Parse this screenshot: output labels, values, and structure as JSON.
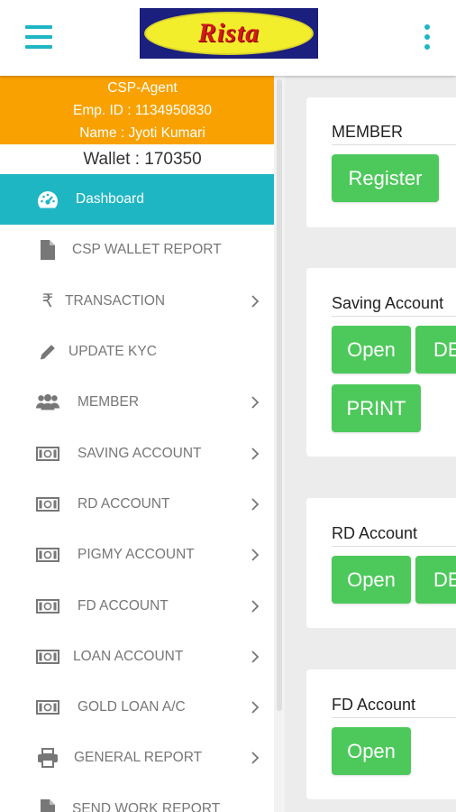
{
  "header": {
    "logo_text": "Rista",
    "menu_icon": "hamburger-menu-icon",
    "overflow_icon": "kebab-menu-icon",
    "brand_color": "#1fb6c4"
  },
  "sidebar": {
    "role": "CSP-Agent",
    "emp_id": "Emp. ID : 1134950830",
    "name": "Name : Jyoti Kumari",
    "wallet": "Wallet : 170350",
    "accent_color": "#f9a100",
    "items": [
      {
        "label": "Dashboard",
        "icon": "dashboard-gauge-icon",
        "active": true,
        "chevron": false
      },
      {
        "label": "CSP WALLET REPORT",
        "icon": "document-icon",
        "active": false,
        "chevron": false
      },
      {
        "label": "TRANSACTION",
        "icon": "rupee-icon",
        "active": false,
        "chevron": true
      },
      {
        "label": "UPDATE KYC",
        "icon": "pencil-icon",
        "active": false,
        "chevron": false
      },
      {
        "label": "MEMBER",
        "icon": "users-icon",
        "active": false,
        "chevron": true
      },
      {
        "label": "SAVING ACCOUNT",
        "icon": "money-icon",
        "active": false,
        "chevron": true
      },
      {
        "label": "RD ACCOUNT",
        "icon": "money-icon",
        "active": false,
        "chevron": true
      },
      {
        "label": "PIGMY ACCOUNT",
        "icon": "money-icon",
        "active": false,
        "chevron": true
      },
      {
        "label": "FD ACCOUNT",
        "icon": "money-icon",
        "active": false,
        "chevron": true
      },
      {
        "label": "LOAN ACCOUNT",
        "icon": "money-icon",
        "active": false,
        "chevron": true
      },
      {
        "label": "GOLD LOAN A/C",
        "icon": "money-icon",
        "active": false,
        "chevron": true
      },
      {
        "label": "GENERAL REPORT",
        "icon": "printer-icon",
        "active": false,
        "chevron": true
      },
      {
        "label": "SEND WORK REPORT",
        "icon": "document-icon",
        "active": false,
        "chevron": false
      }
    ]
  },
  "main": {
    "cards": [
      {
        "title": "MEMBER",
        "buttons": [
          "Register"
        ]
      },
      {
        "title": "Saving Account",
        "buttons": [
          "Open",
          "DE",
          "PRINT"
        ]
      },
      {
        "title": "RD Account",
        "buttons": [
          "Open",
          "DE"
        ]
      },
      {
        "title": "FD Account",
        "buttons": [
          "Open"
        ]
      }
    ],
    "button_color": "#4dc95b"
  }
}
